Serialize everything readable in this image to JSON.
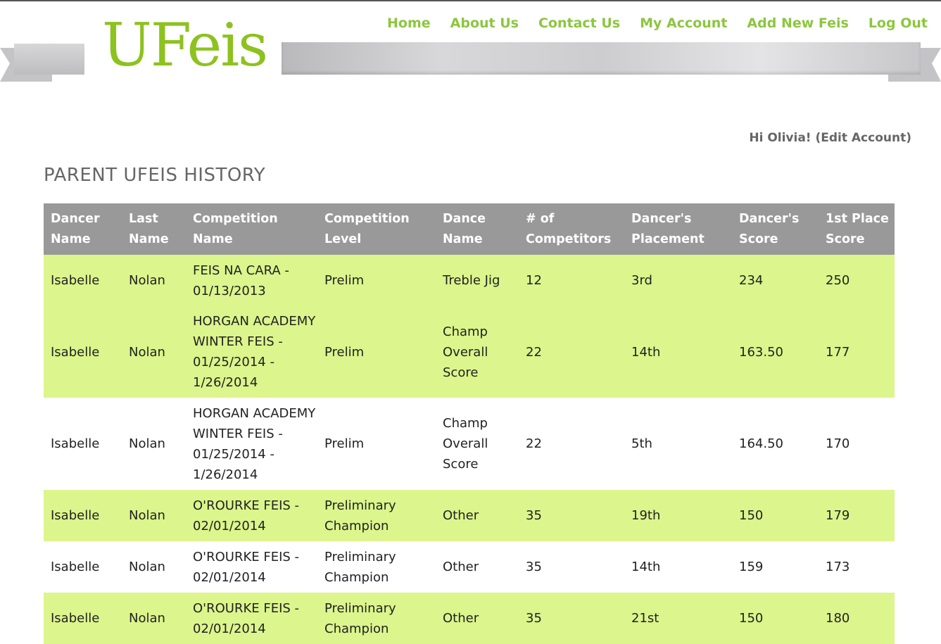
{
  "brand": {
    "logo_text": "UFeis",
    "accent": "#8dc21f",
    "nav_color": "#8cc63f",
    "row_highlight": "#dcf58c",
    "header_bg": "#999999"
  },
  "nav": [
    "Home",
    "About Us",
    "Contact Us",
    "My Account",
    "Add New Feis",
    "Log Out"
  ],
  "greeting": "Hi Olivia! (Edit Account)",
  "page_title": "PARENT UFEIS HISTORY",
  "table": {
    "headers": [
      [
        "Dancer",
        "Name"
      ],
      [
        "Last",
        "Name"
      ],
      [
        "Competition",
        "Name"
      ],
      [
        "Competition",
        "Level"
      ],
      [
        "Dance",
        "Name"
      ],
      [
        "# of",
        "Competitors"
      ],
      [
        "Dancer's",
        "Placement"
      ],
      [
        "Dancer's",
        "Score"
      ],
      [
        "1st Place",
        "Score"
      ]
    ],
    "rows": [
      {
        "dancer": "Isabelle",
        "last": "Nolan",
        "competition": [
          "FEIS NA CARA -",
          "01/13/2013"
        ],
        "level": [
          "Prelim"
        ],
        "dance": [
          "Treble Jig"
        ],
        "competitors": "12",
        "placement": "3rd",
        "score": "234",
        "first_place": "250"
      },
      {
        "dancer": "Isabelle",
        "last": "Nolan",
        "competition": [
          "HORGAN ACADEMY",
          "WINTER FEIS -",
          "01/25/2014 -",
          "1/26/2014"
        ],
        "level": [
          "Prelim"
        ],
        "dance": [
          "Champ",
          "Overall",
          "Score"
        ],
        "competitors": "22",
        "placement": "14th",
        "score": "163.50",
        "first_place": "177"
      },
      {
        "dancer": "Isabelle",
        "last": "Nolan",
        "competition": [
          "HORGAN ACADEMY",
          "WINTER FEIS -",
          "01/25/2014 -",
          "1/26/2014"
        ],
        "level": [
          "Prelim"
        ],
        "dance": [
          "Champ",
          "Overall",
          "Score"
        ],
        "competitors": "22",
        "placement": "5th",
        "score": "164.50",
        "first_place": "170"
      },
      {
        "dancer": "Isabelle",
        "last": "Nolan",
        "competition": [
          "O'ROURKE FEIS -",
          "02/01/2014"
        ],
        "level": [
          "Preliminary",
          "Champion"
        ],
        "dance": [
          "Other"
        ],
        "competitors": "35",
        "placement": "19th",
        "score": "150",
        "first_place": "179"
      },
      {
        "dancer": "Isabelle",
        "last": "Nolan",
        "competition": [
          "O'ROURKE FEIS -",
          "02/01/2014"
        ],
        "level": [
          "Preliminary",
          "Champion"
        ],
        "dance": [
          "Other"
        ],
        "competitors": "35",
        "placement": "14th",
        "score": "159",
        "first_place": "173"
      },
      {
        "dancer": "Isabelle",
        "last": "Nolan",
        "competition": [
          "O'ROURKE FEIS -",
          "02/01/2014"
        ],
        "level": [
          "Preliminary",
          "Champion"
        ],
        "dance": [
          "Other"
        ],
        "competitors": "35",
        "placement": "21st",
        "score": "150",
        "first_place": "180"
      }
    ]
  }
}
